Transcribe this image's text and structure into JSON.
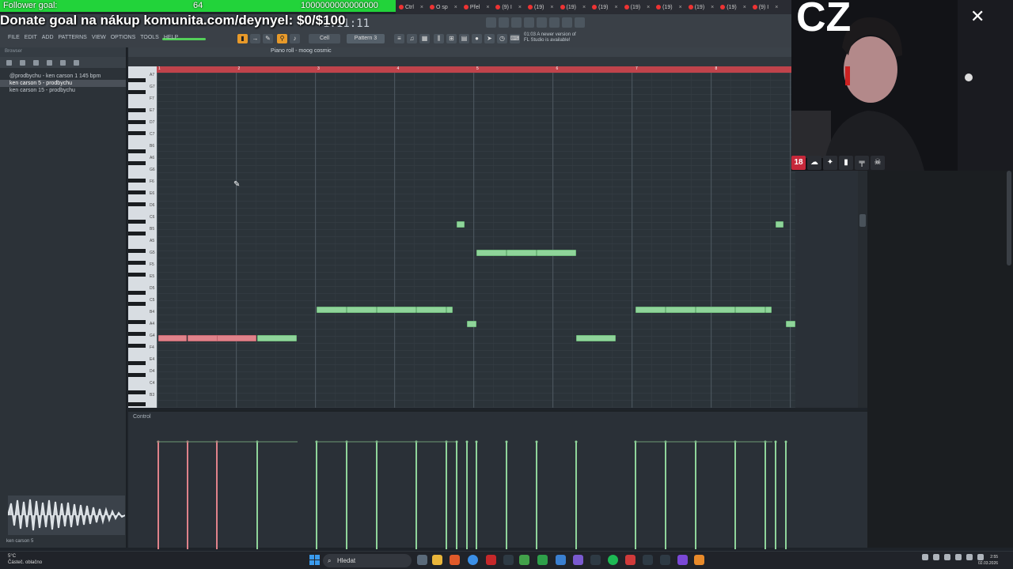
{
  "overlay": {
    "goal_label": "Follower goal:",
    "goal_count": "64",
    "goal_target": "1000000000000000",
    "donate_text": "Donate goal na nákup komunita.com/deynyel: $0/$100"
  },
  "browser_tabs": [
    "Ctrl",
    "O sp",
    "Přel",
    "(9) I",
    "(19)",
    "(19)",
    "(19)",
    "(19)",
    "(19)",
    "(19)",
    "(19)",
    "(9) I"
  ],
  "fl": {
    "menu": [
      "FILE",
      "EDIT",
      "ADD",
      "PATTERNS",
      "VIEW",
      "OPTIONS",
      "TOOLS",
      "HELP"
    ],
    "time": "1:11:11",
    "pattern": "Pattern 3",
    "snap": "Cell",
    "update_note_1": "01:03 A newer version of",
    "update_note_2": "FL Studio is available!"
  },
  "browser": {
    "title": "Browser",
    "items": [
      {
        "label": "@prodbychu - ken carson 1 145 bpm"
      },
      {
        "label": "ken carson 5 - prodbychu"
      },
      {
        "label": "ken carson 15 - prodbychu"
      }
    ],
    "footer": "ken carson 5"
  },
  "piano_roll": {
    "title": "Piano roll - moog cosmic",
    "ruler_marks": [
      "1",
      "2",
      "3",
      "4",
      "5",
      "6",
      "7",
      "8"
    ],
    "key_labels": [
      "A7",
      "G7",
      "F7",
      "E7",
      "D7",
      "C7",
      "B6",
      "A6",
      "G6",
      "F6",
      "E6",
      "D6",
      "C6",
      "B5",
      "A5",
      "G5",
      "F5",
      "E5",
      "D5",
      "C5",
      "B4",
      "A4",
      "G4",
      "F4",
      "E4",
      "D4",
      "C4",
      "B3"
    ],
    "control_label": "Control"
  },
  "webcam": {
    "brand": "CZ"
  },
  "colors": {
    "goal_bar": "#22d33a",
    "note_green": "#8fd49a",
    "note_red": "#e0828a",
    "ruler": "#c0434b"
  },
  "taskbar": {
    "weather_temp": "5°C",
    "weather_desc": "Částeč. oblačno",
    "search_placeholder": "Hledat",
    "time": "2:55",
    "date": "02.03.2026"
  }
}
